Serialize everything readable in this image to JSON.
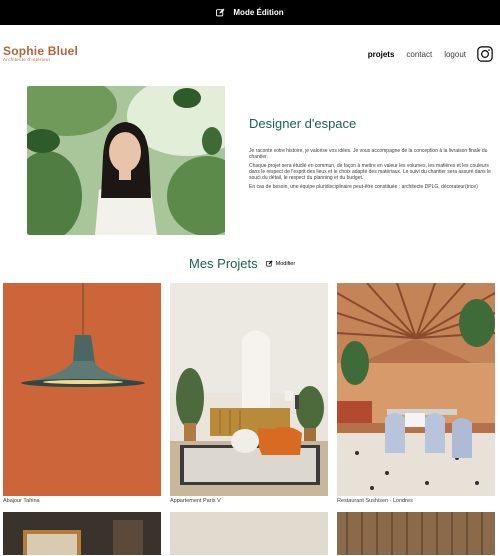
{
  "edit_bar": {
    "label": "Mode Édition",
    "icon": "pen-square-icon"
  },
  "header": {
    "logo_name": "Sophie Bluel",
    "logo_subtitle": "Architecte d'intérieur",
    "nav": [
      {
        "label": "projets",
        "active": true
      },
      {
        "label": "contact",
        "active": false
      },
      {
        "label": "logout",
        "active": false
      }
    ],
    "instagram_icon": "instagram-icon"
  },
  "intro": {
    "title": "Designer d'espace",
    "paragraphs": [
      "Je raconte votre histoire, je valorise vos idées. Je vous accompagne de la conception à la livraison finale du chantier.",
      "Chaque projet sera étudié en commun, de façon à mettre en valeur les volumes, les matières et les couleurs dans le respect de l'esprit des lieux et le choix adapté des matériaux. Le suivi du chantier sera assuré dans le souci du détail, le respect du planning et du budget.",
      "En cas de besoin, une équipe pluridisciplinaire peut-être constituée : architecte DPLG, décorateur(trice)"
    ]
  },
  "projects": {
    "title": "Mes Projets",
    "modify_label": "Modifier",
    "items": [
      {
        "caption": "Abajour Tahina"
      },
      {
        "caption": "Appartement Paris V"
      },
      {
        "caption": "Restaurant Sushisen - Londres"
      }
    ]
  },
  "colors": {
    "accent": "#1d6154",
    "brand": "#b1663c",
    "edit_bar": "#000000"
  }
}
